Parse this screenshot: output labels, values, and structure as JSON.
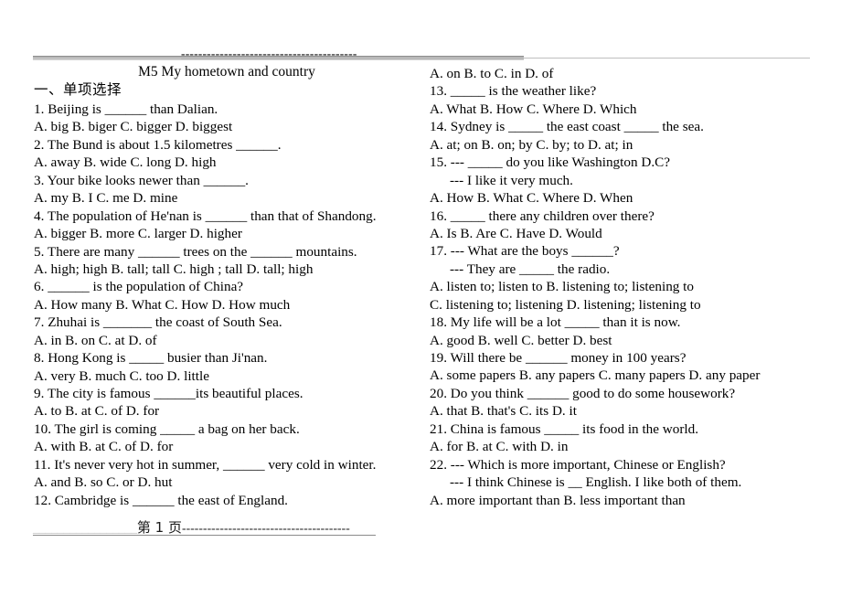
{
  "document": {
    "title": "M5 My hometown and country",
    "section_heading": "一、单项选择",
    "header_rule": {
      "gray_run": "________________________",
      "dark_run": "-----------------------------------------"
    },
    "footer": {
      "gray_run": "_________________",
      "page_label": "第 1 页",
      "dark_run": "----------------------------------------"
    }
  },
  "left_column": {
    "lines": [
      {
        "text": "1. Beijing is ______ than Dalian."
      },
      {
        "text": "A. big    B. biger    C. bigger    D. biggest"
      },
      {
        "text": "2. The Bund is about 1.5 kilometres ______."
      },
      {
        "text": "A. away    B. wide    C. long    D. high"
      },
      {
        "text": "3. Your bike looks newer than ______."
      },
      {
        "text": "A. my    B. I    C. me    D. mine"
      },
      {
        "text": "4. The population of He'nan is ______ than that of Shandong."
      },
      {
        "text": "A. bigger    B. more    C. larger    D. higher"
      },
      {
        "text": "5. There are many ______ trees on the ______ mountains."
      },
      {
        "text": "A. high; high    B. tall; tall    C. high ; tall    D. tall; high"
      },
      {
        "text": "6. ______ is the population of China?"
      },
      {
        "text": "A. How many    B. What    C. How    D. How much"
      },
      {
        "text": "7. Zhuhai is _______ the coast of South Sea."
      },
      {
        "text": "A. in    B. on    C. at    D. of"
      },
      {
        "text": "8. Hong Kong is _____ busier than Ji'nan."
      },
      {
        "text": "A. very    B. much    C. too    D. little"
      },
      {
        "text": "9. The city is famous ______its beautiful places."
      },
      {
        "text": "A. to    B. at    C. of    D. for"
      },
      {
        "text": "10. The girl is coming _____ a bag on her back."
      },
      {
        "text": "A. with    B. at    C. of    D. for"
      },
      {
        "text": "11. It's never very hot in summer, ______ very cold in winter."
      },
      {
        "text": "A. and    B. so    C. or    D. hut"
      },
      {
        "text": "12. Cambridge is ______ the east of England."
      }
    ]
  },
  "right_column": {
    "lines": [
      {
        "text": "A. on    B. to    C. in    D. of",
        "indent": false
      },
      {
        "text": "13. _____ is the weather like?",
        "indent": false
      },
      {
        "text": "A. What    B. How    C. Where    D. Which",
        "indent": false
      },
      {
        "text": "14. Sydney is _____ the east coast _____ the sea.",
        "indent": false
      },
      {
        "text": "A. at; on    B. on; by    C. by; to    D. at; in",
        "indent": false
      },
      {
        "text": "15. --- _____ do you like Washington D.C?",
        "indent": false
      },
      {
        "text": "--- I like it very much.",
        "indent": true
      },
      {
        "text": "A. How    B. What    C. Where    D. When",
        "indent": false
      },
      {
        "text": "16. _____ there any children over there?",
        "indent": false
      },
      {
        "text": "A. Is    B. Are    C. Have    D. Would",
        "indent": false
      },
      {
        "text": "17. --- What are the boys ______?",
        "indent": false
      },
      {
        "text": "--- They are _____ the radio.",
        "indent": true
      },
      {
        "text": "A. listen to; listen to          B. listening to; listening to",
        "indent": false
      },
      {
        "text": "C. listening to; listening    D. listening; listening to",
        "indent": false
      },
      {
        "text": "18. My life will be a lot _____ than it is now.",
        "indent": false
      },
      {
        "text": "A. good    B. well    C. better    D. best",
        "indent": false
      },
      {
        "text": "19. Will there be ______ money in 100 years?",
        "indent": false
      },
      {
        "text": "A. some papers    B. any papers    C. many papers    D. any paper",
        "indent": false
      },
      {
        "text": "20. Do you think ______ good to do some housework?",
        "indent": false
      },
      {
        "text": "A. that    B. that's    C. its    D. it",
        "indent": false
      },
      {
        "text": "21. China is famous _____ its food in the world.",
        "indent": false
      },
      {
        "text": "A. for    B. at    C. with    D. in",
        "indent": false
      },
      {
        "text": "22. --- Which is more important, Chinese or English?",
        "indent": false
      },
      {
        "text": "--- I think Chinese is __ English. I like both of them.",
        "indent": true
      },
      {
        "text": "A. more important than    B. less important than",
        "indent": false
      }
    ]
  }
}
